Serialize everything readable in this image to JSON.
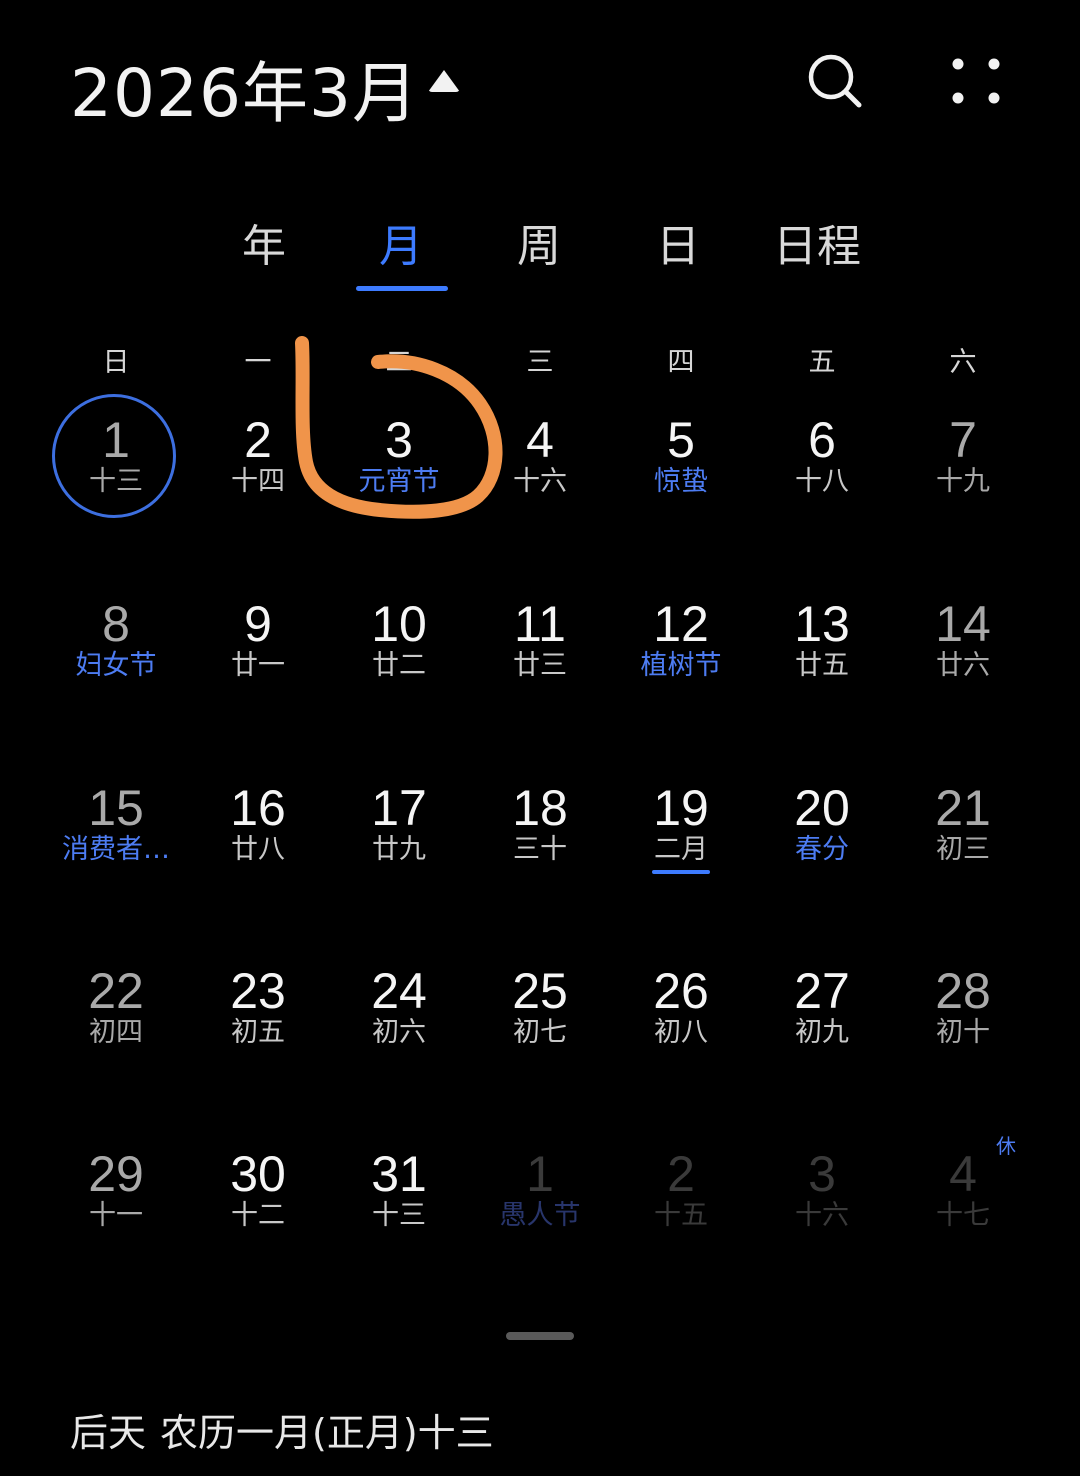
{
  "header": {
    "title": "2026年3月",
    "search_icon": "search-icon",
    "more_icon": "more-dots-icon"
  },
  "tabs": [
    {
      "label": "年",
      "active": false
    },
    {
      "label": "月",
      "active": true
    },
    {
      "label": "周",
      "active": false
    },
    {
      "label": "日",
      "active": false
    },
    {
      "label": "日程",
      "active": false
    }
  ],
  "weekdays": [
    "日",
    "一",
    "二",
    "三",
    "四",
    "五",
    "六"
  ],
  "weeks": [
    [
      {
        "day": "1",
        "lunar": "十三",
        "today": true
      },
      {
        "day": "2",
        "lunar": "十四"
      },
      {
        "day": "3",
        "lunar": "元宵节",
        "festival": true
      },
      {
        "day": "4",
        "lunar": "十六"
      },
      {
        "day": "5",
        "lunar": "惊蛰",
        "festival": true
      },
      {
        "day": "6",
        "lunar": "十八"
      },
      {
        "day": "7",
        "lunar": "十九"
      }
    ],
    [
      {
        "day": "8",
        "lunar": "妇女节",
        "festival": true
      },
      {
        "day": "9",
        "lunar": "廿一"
      },
      {
        "day": "10",
        "lunar": "廿二"
      },
      {
        "day": "11",
        "lunar": "廿三"
      },
      {
        "day": "12",
        "lunar": "植树节",
        "festival": true
      },
      {
        "day": "13",
        "lunar": "廿五"
      },
      {
        "day": "14",
        "lunar": "廿六"
      }
    ],
    [
      {
        "day": "15",
        "lunar": "消费者…",
        "festival": true
      },
      {
        "day": "16",
        "lunar": "廿八"
      },
      {
        "day": "17",
        "lunar": "廿九"
      },
      {
        "day": "18",
        "lunar": "三十"
      },
      {
        "day": "19",
        "lunar": "二月",
        "month_start": true
      },
      {
        "day": "20",
        "lunar": "春分",
        "festival": true
      },
      {
        "day": "21",
        "lunar": "初三"
      }
    ],
    [
      {
        "day": "22",
        "lunar": "初四"
      },
      {
        "day": "23",
        "lunar": "初五"
      },
      {
        "day": "24",
        "lunar": "初六"
      },
      {
        "day": "25",
        "lunar": "初七"
      },
      {
        "day": "26",
        "lunar": "初八"
      },
      {
        "day": "27",
        "lunar": "初九"
      },
      {
        "day": "28",
        "lunar": "初十"
      }
    ],
    [
      {
        "day": "29",
        "lunar": "十一"
      },
      {
        "day": "30",
        "lunar": "十二"
      },
      {
        "day": "31",
        "lunar": "十三"
      },
      {
        "day": "1",
        "lunar": "愚人节",
        "festival": true,
        "next_month": true
      },
      {
        "day": "2",
        "lunar": "十五",
        "next_month": true
      },
      {
        "day": "3",
        "lunar": "十六",
        "next_month": true
      },
      {
        "day": "4",
        "lunar": "十七",
        "next_month": true,
        "badge": "休"
      }
    ]
  ],
  "footer": {
    "relative": "后天",
    "lunar_date": "农历一月(正月)十三"
  },
  "colors": {
    "accent": "#3d7bff",
    "annotation": "#f0944a"
  }
}
